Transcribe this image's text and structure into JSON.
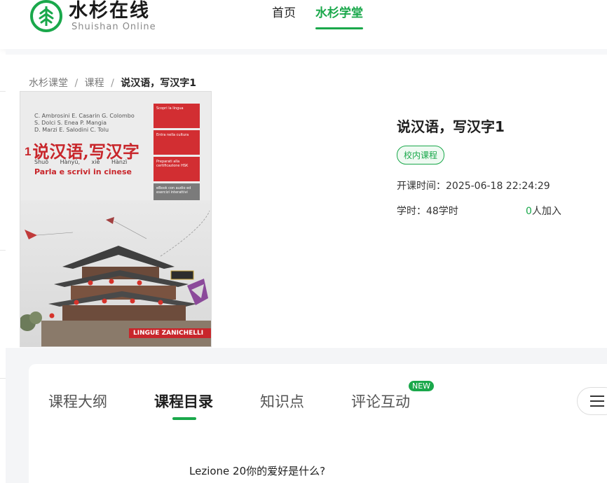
{
  "header": {
    "logo_cn": "水杉在线",
    "logo_en": "Shuishan   Online",
    "nav": [
      {
        "label": "首页",
        "active": false
      },
      {
        "label": "水杉学堂",
        "active": true
      }
    ]
  },
  "breadcrumb": {
    "items": [
      "水杉课堂",
      "课程"
    ],
    "separator": "/",
    "current": "说汉语，写汉字1"
  },
  "cover": {
    "authors": [
      "C. Ambrosini  E. Casarin  G. Colombo",
      "S. Dolci  S. Enea  P. Mangia",
      "D. Marzi  E. Salodini  C. Tolu"
    ],
    "title_number": "1",
    "title_cn": "说汉语,写汉字",
    "pinyin": "Shuō Hànyǔ, xiě Hànzì",
    "subtitle": "Parla e scrivi in cinese",
    "tags": [
      "Scopri la lingua",
      "Entra nella cultura",
      "Preparati alla certificazione HSK",
      "eBook con audio ed esercizi interattivi"
    ],
    "publisher": "LINGUE ZANICHELLI"
  },
  "course": {
    "title": "说汉语，写汉字1",
    "badge": "校内课程",
    "start_label": "开课时间：",
    "start_time": "2025-06-18 22:24:29",
    "hours_label": "学时：",
    "hours": "48学时",
    "joined_count": "0",
    "joined_suffix": "人加入"
  },
  "tabs": [
    {
      "label": "课程大纲",
      "active": false
    },
    {
      "label": "课程目录",
      "active": true
    },
    {
      "label": "知识点",
      "active": false
    },
    {
      "label": "评论互动",
      "active": false,
      "badge": "NEW"
    }
  ],
  "lesson": {
    "title": "Lezione 20你的爱好是什么?"
  },
  "colors": {
    "brand_green": "#1aa84b",
    "cover_red": "#c8262b"
  }
}
